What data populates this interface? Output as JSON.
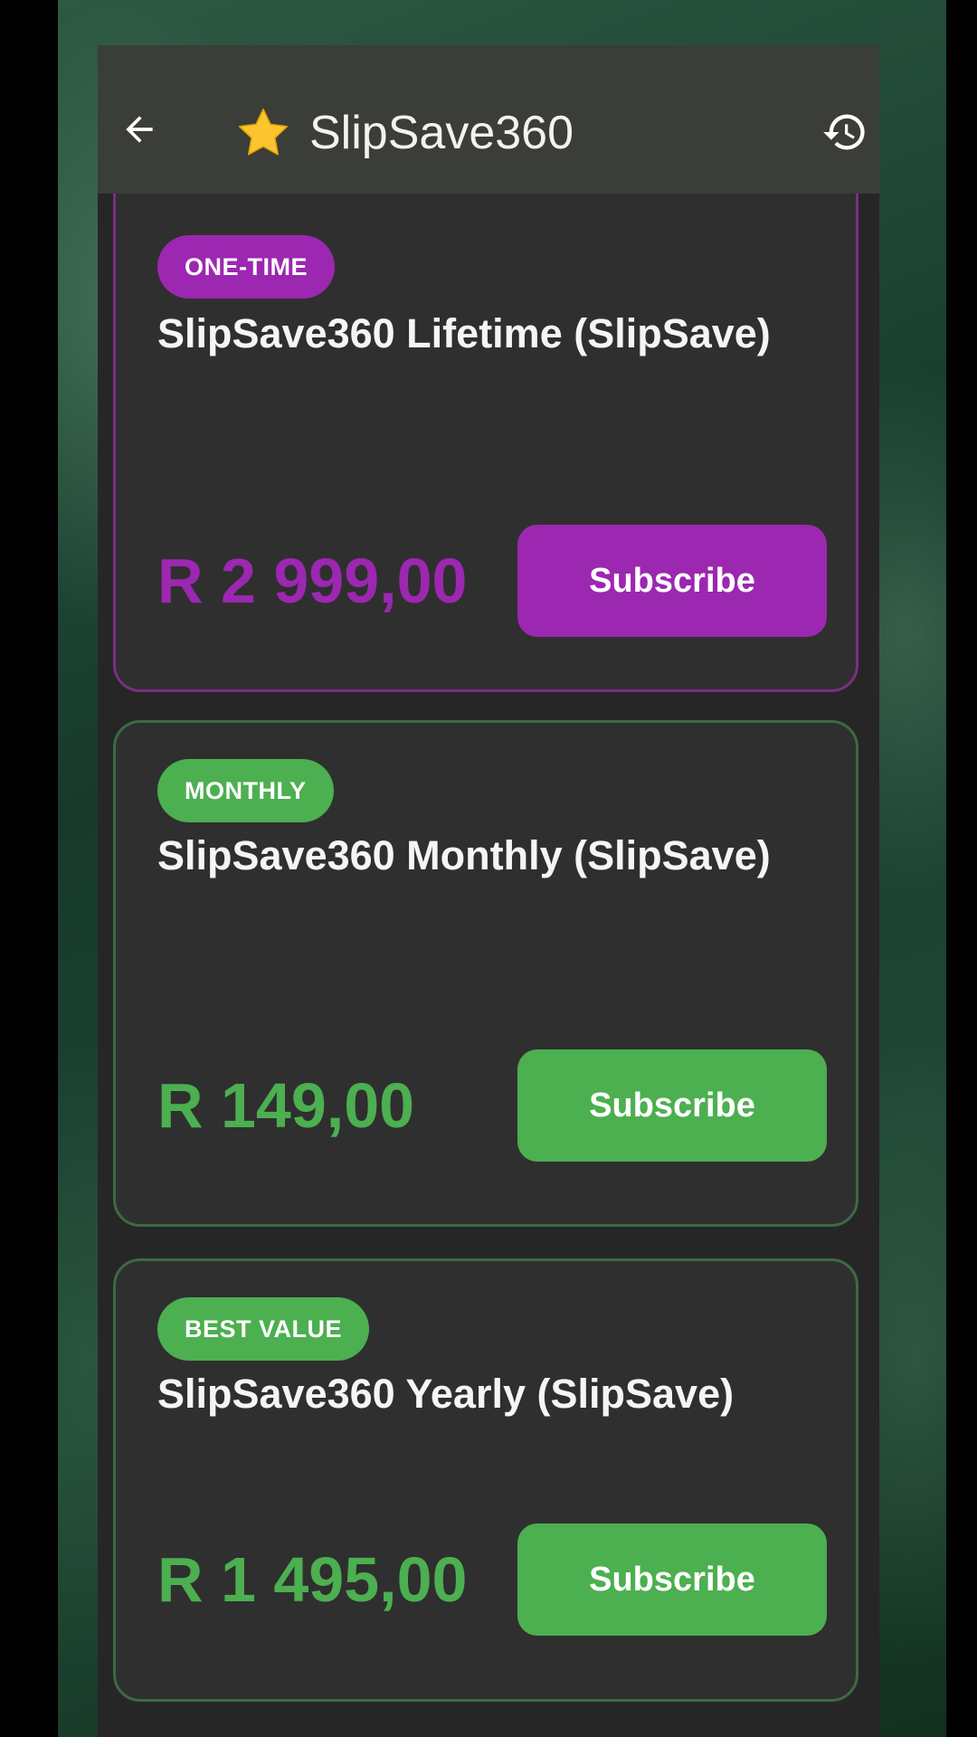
{
  "appbar": {
    "title": "SlipSave360",
    "back_icon": "arrow-left-icon",
    "title_icon": "star-icon",
    "history_icon": "history-icon"
  },
  "colors": {
    "purple": "#9c27b0",
    "green": "#4caf50",
    "card_bg": "#2f2f2f",
    "appbar_bg": "#3a3d38"
  },
  "plans": [
    {
      "badge": "ONE-TIME",
      "name": "SlipSave360 Lifetime (SlipSave)",
      "price": "R 2 999,00",
      "button": "Subscribe",
      "accent": "purple"
    },
    {
      "badge": "MONTHLY",
      "name": "SlipSave360 Monthly (SlipSave)",
      "price": "R 149,00",
      "button": "Subscribe",
      "accent": "green"
    },
    {
      "badge": "BEST VALUE",
      "name": "SlipSave360 Yearly (SlipSave)",
      "price": "R 1 495,00",
      "button": "Subscribe",
      "accent": "green"
    }
  ]
}
